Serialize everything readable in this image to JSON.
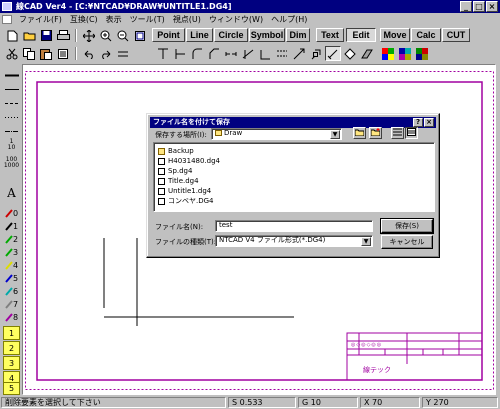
{
  "window": {
    "title": "線CAD Ver4 - [C:¥NTCAD¥DRAW¥UNTITLE1.DG4]",
    "min": "_",
    "max": "□",
    "close": "×"
  },
  "menu": [
    "ファイル(F)",
    "互換(C)",
    "表示",
    "ツール(T)",
    "視点(U)",
    "ウィンドウ(W)",
    "ヘルプ(H)"
  ],
  "mode_tabs": [
    "Point",
    "Line",
    "Circle",
    "Symbol",
    "Dim",
    "Text",
    "Edit",
    "Move",
    "Calc",
    "CUT"
  ],
  "active_tab": "Edit",
  "left_palette": {
    "text_tool": "A",
    "pens": [
      "0",
      "1",
      "2",
      "3",
      "4",
      "5",
      "6",
      "7",
      "8"
    ],
    "layers": [
      "1",
      "2",
      "3",
      "4",
      "5"
    ],
    "scale_labels": [
      "1",
      "10",
      "100",
      "1000"
    ]
  },
  "colors": {
    "frame": "#a000a0",
    "title_bg": "#000080",
    "canvas": "#ffffff"
  },
  "title_block": {
    "company": "線テック",
    "marks": "◎◇◎◇◎◎"
  },
  "dialog": {
    "title": "ファイル名を付けて保存",
    "help": "?",
    "close": "×",
    "save_in_label": "保存する場所(I):",
    "save_in_value": "Draw",
    "files": [
      {
        "name": "Backup",
        "type": "folder"
      },
      {
        "name": "H4031480.dg4",
        "type": "file"
      },
      {
        "name": "Sp.dg4",
        "type": "file"
      },
      {
        "name": "Title.dg4",
        "type": "file"
      },
      {
        "name": "Untitle1.dg4",
        "type": "file"
      },
      {
        "name": "コンベヤ.DG4",
        "type": "file"
      }
    ],
    "filename_label": "ファイル名(N):",
    "filename_value": "test",
    "filetype_label": "ファイルの種類(T):",
    "filetype_value": "NTCAD V4 ファイル形式(*.DG4)",
    "save_button": "保存(S)",
    "cancel_button": "キャンセル"
  },
  "status": {
    "message": "削除要素を選択して下さい",
    "s": "S 0.533",
    "g": "G 10",
    "x": "X 70",
    "y": "Y 270"
  }
}
